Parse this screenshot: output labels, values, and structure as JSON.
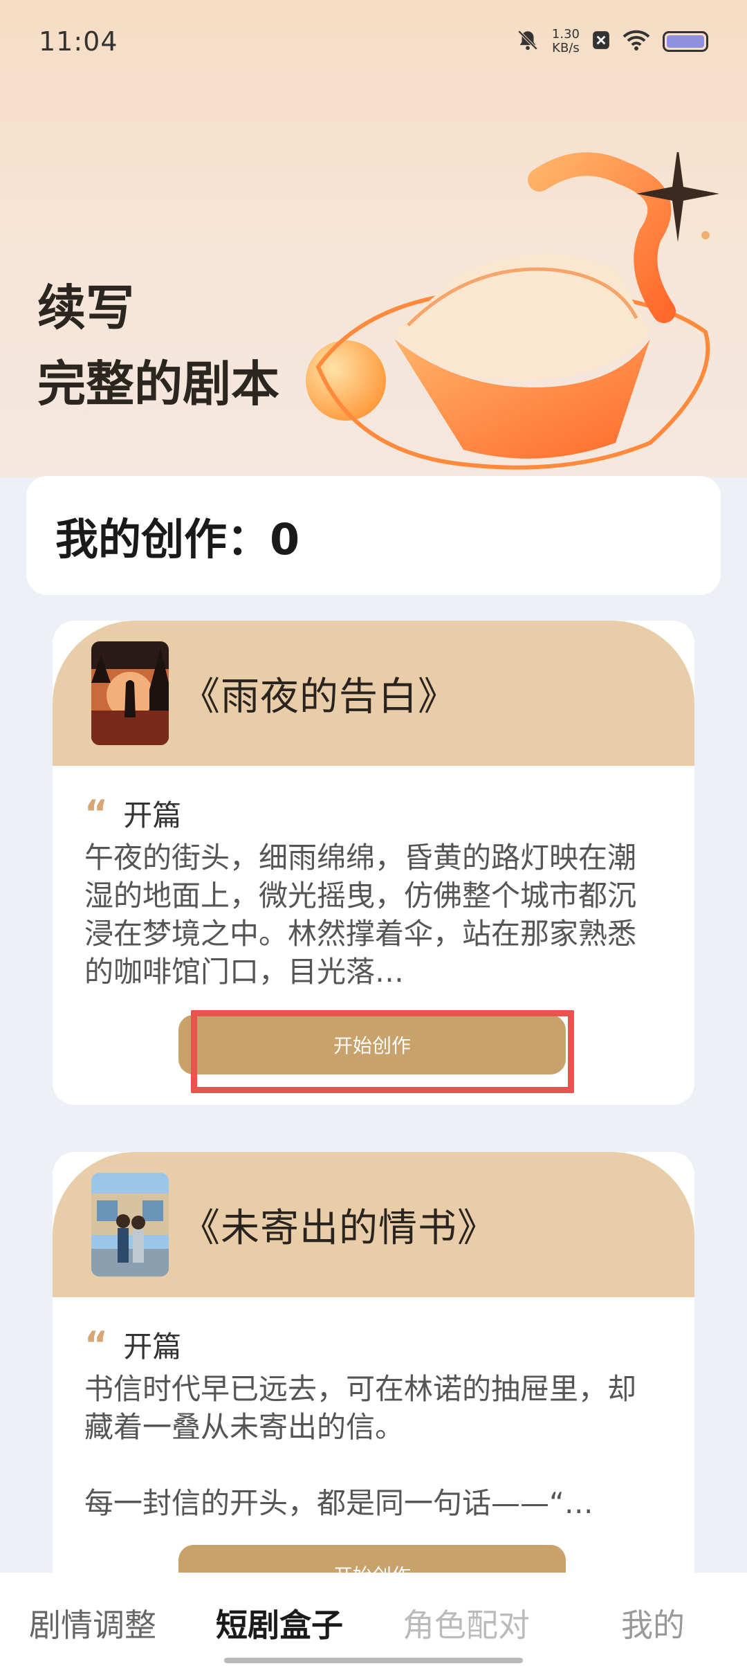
{
  "status_bar": {
    "time": "11:04",
    "speed_value": "1.30",
    "speed_unit": "KB/s",
    "icons": [
      "bell-off-icon",
      "close-box-icon",
      "wifi-icon",
      "battery-icon"
    ]
  },
  "hero": {
    "title_line1": "续写",
    "title_line2": "完整的剧本"
  },
  "my_works": {
    "text": "我的创作：0"
  },
  "stories": [
    {
      "title": "《雨夜的告白》",
      "opening_label": "开篇",
      "excerpt": "午夜的街头，细雨绵绵，昏黄的路灯映在潮湿的地面上，微光摇曳，仿佛整个城市都沉浸在梦境之中。林然撑着伞，站在那家熟悉的咖啡馆门口，目光落…",
      "button_label": "开始创作"
    },
    {
      "title": "《未寄出的情书》",
      "opening_label": "开篇",
      "excerpt": "书信时代早已远去，可在林诺的抽屉里，却藏着一叠从未寄出的信。\n\n每一封信的开头，都是同一句话——“…",
      "button_label": "开始创作"
    }
  ],
  "tabs": [
    {
      "label": "剧情调整",
      "active": false
    },
    {
      "label": "短剧盒子",
      "active": true
    },
    {
      "label": "角色配对",
      "active": false
    },
    {
      "label": "我的",
      "active": false
    }
  ],
  "colors": {
    "accent": "#c9a16a",
    "card_header": "#e9cda8",
    "highlight": "#e8544e"
  }
}
